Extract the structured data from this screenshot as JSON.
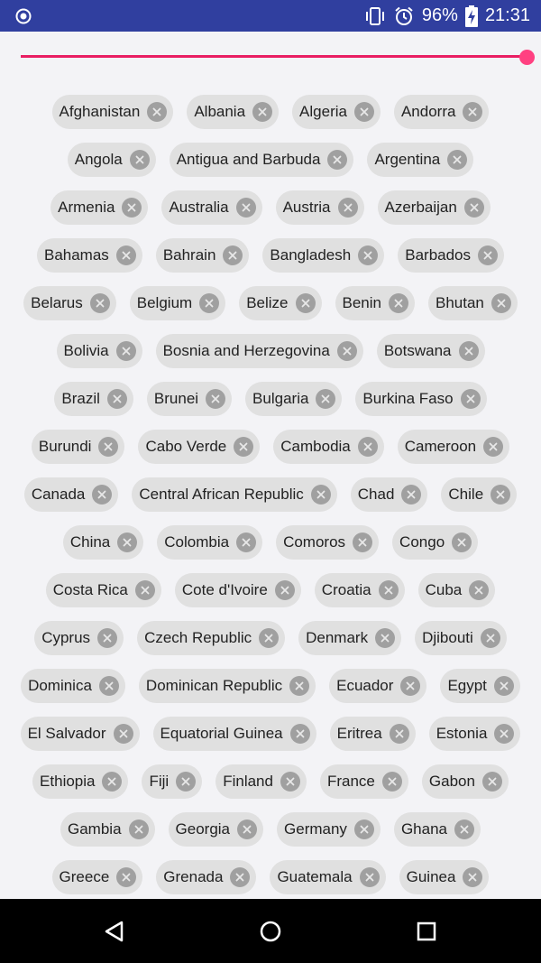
{
  "status_bar": {
    "battery_percent": "96%",
    "time": "21:31",
    "icons": [
      "radio-button-icon",
      "vibrate-icon",
      "alarm-icon",
      "battery-charging-icon"
    ]
  },
  "slider": {
    "value": 1.0,
    "track_color": "#e91e63",
    "thumb_color": "#ff4081"
  },
  "chips": {
    "rows": [
      [
        "Afghanistan",
        "Albania",
        "Algeria",
        "Andorra"
      ],
      [
        "Angola",
        "Antigua and Barbuda",
        "Argentina"
      ],
      [
        "Armenia",
        "Australia",
        "Austria",
        "Azerbaijan"
      ],
      [
        "Bahamas",
        "Bahrain",
        "Bangladesh",
        "Barbados"
      ],
      [
        "Belarus",
        "Belgium",
        "Belize",
        "Benin",
        "Bhutan"
      ],
      [
        "Bolivia",
        "Bosnia and Herzegovina",
        "Botswana"
      ],
      [
        "Brazil",
        "Brunei",
        "Bulgaria",
        "Burkina Faso"
      ],
      [
        "Burundi",
        "Cabo Verde",
        "Cambodia",
        "Cameroon"
      ],
      [
        "Canada",
        "Central African Republic",
        "Chad",
        "Chile"
      ],
      [
        "China",
        "Colombia",
        "Comoros",
        "Congo"
      ],
      [
        "Costa Rica",
        "Cote d'Ivoire",
        "Croatia",
        "Cuba"
      ],
      [
        "Cyprus",
        "Czech Republic",
        "Denmark",
        "Djibouti"
      ],
      [
        "Dominica",
        "Dominican Republic",
        "Ecuador",
        "Egypt"
      ],
      [
        "El Salvador",
        "Equatorial Guinea",
        "Eritrea",
        "Estonia"
      ],
      [
        "Ethiopia",
        "Fiji",
        "Finland",
        "France",
        "Gabon"
      ],
      [
        "Gambia",
        "Georgia",
        "Germany",
        "Ghana"
      ],
      [
        "Greece",
        "Grenada",
        "Guatemala",
        "Guinea"
      ]
    ],
    "close_icon": "close-circle-icon"
  },
  "nav_bar": {
    "icons": [
      "back-icon",
      "home-icon",
      "recents-icon"
    ]
  }
}
